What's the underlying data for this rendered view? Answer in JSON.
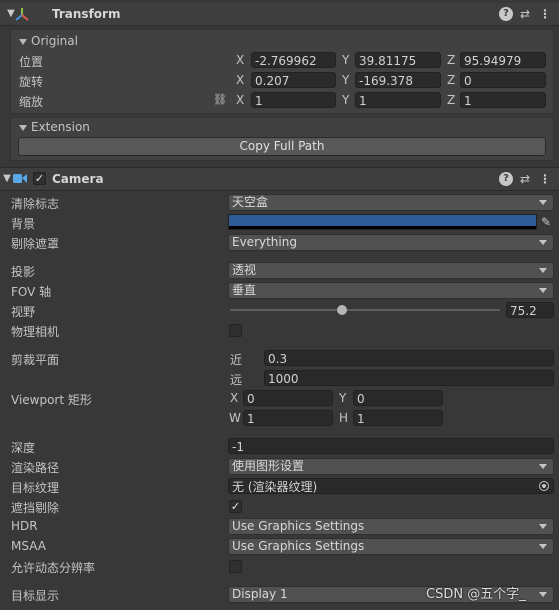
{
  "transform": {
    "title": "Transform",
    "original": {
      "label": "Original",
      "rows": [
        {
          "label": "位置",
          "x": "-2.769962",
          "y": "39.81175",
          "z": "95.94979"
        },
        {
          "label": "旋转",
          "x": "0.207",
          "y": "-169.378",
          "z": "0"
        },
        {
          "label": "缩放",
          "x": "1",
          "y": "1",
          "z": "1"
        }
      ]
    },
    "extension": {
      "label": "Extension",
      "button": "Copy Full Path"
    }
  },
  "axis": {
    "x": "X",
    "y": "Y",
    "z": "Z",
    "w": "W",
    "h": "H"
  },
  "camera": {
    "title": "Camera",
    "enabled": true,
    "clear_flags": {
      "label": "清除标志",
      "value": "天空盒"
    },
    "background": {
      "label": "背景",
      "color": "#2f5a98"
    },
    "culling_mask": {
      "label": "剔除遮罩",
      "value": "Everything"
    },
    "projection": {
      "label": "投影",
      "value": "透视"
    },
    "fov_axis": {
      "label": "FOV 轴",
      "value": "垂直"
    },
    "fov": {
      "label": "视野",
      "value": "75.2",
      "fraction": 0.415
    },
    "physical_camera": {
      "label": "物理相机",
      "checked": false
    },
    "clipping": {
      "label": "剪裁平面",
      "near_label": "近",
      "near": "0.3",
      "far_label": "远",
      "far": "1000"
    },
    "viewport": {
      "label": "Viewport 矩形",
      "x": "0",
      "y": "0",
      "w": "1",
      "h": "1"
    },
    "depth": {
      "label": "深度",
      "value": "-1"
    },
    "rendering_path": {
      "label": "渲染路径",
      "value": "使用图形设置"
    },
    "target_texture": {
      "label": "目标纹理",
      "value": "无 (渲染器纹理)"
    },
    "occlusion_culling": {
      "label": "遮挡剔除",
      "checked": true
    },
    "hdr": {
      "label": "HDR",
      "value": "Use Graphics Settings"
    },
    "msaa": {
      "label": "MSAA",
      "value": "Use Graphics Settings"
    },
    "dynamic_resolution": {
      "label": "允许动态分辨率",
      "checked": false
    },
    "target_display": {
      "label": "目标显示",
      "value": "Display 1"
    }
  },
  "watermark": "CSDN @五个字_"
}
